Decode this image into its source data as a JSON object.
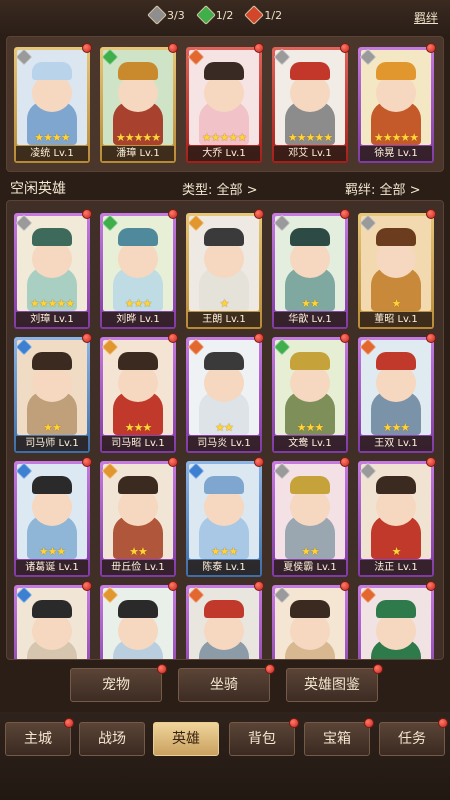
{
  "resources": [
    {
      "icon": "gray-gem-icon",
      "value": "3/3",
      "color": "#8e8e8e"
    },
    {
      "icon": "green-gem-icon",
      "value": "1/2",
      "color": "#3fae4b"
    },
    {
      "icon": "red-gem-icon",
      "value": "1/2",
      "color": "#d2472c"
    }
  ],
  "bond_link": "羁绊",
  "team": [
    {
      "name": "凌统 Lv.1",
      "frame": "gold",
      "elem": "#9a9a9a",
      "stars": "★★★★",
      "bg": "#dbe6f0",
      "clothes": "#7ea6cf",
      "hat": "#b9d3ea"
    },
    {
      "name": "潘璋 Lv.1",
      "frame": "gold",
      "elem": "#3fae4b",
      "stars": "★★★★★",
      "bg": "#cfe3c6",
      "clothes": "#a8422f",
      "hat": "#c98a2e"
    },
    {
      "name": "大乔 Lv.1",
      "frame": "red",
      "elem": "#e2682f",
      "stars": "★★★★★",
      "bg": "#f6e4e4",
      "clothes": "#f1c2c8",
      "hat": "#3a2a24"
    },
    {
      "name": "邓艾 Lv.1",
      "frame": "red",
      "elem": "#9a9a9a",
      "stars": "★★★★★",
      "bg": "#f1ece6",
      "clothes": "#8c8c8c",
      "hat": "#c2372a"
    },
    {
      "name": "徐晃 Lv.1",
      "frame": "purple",
      "elem": "#9a9a9a",
      "stars": "★★★★★",
      "bg": "#f4e7c4",
      "clothes": "#c45a2a",
      "hat": "#e2962e"
    }
  ],
  "idle_section": {
    "title": "空闲英雄",
    "type_filter": "类型: 全部 >",
    "bond_filter": "羁绊: 全部 >"
  },
  "idle_heroes": [
    {
      "name": "刘璋 Lv.1",
      "frame": "purple",
      "elem": "#9a9a9a",
      "stars": "★★★★★",
      "bg": "#f2ead8",
      "clothes": "#a9cfc2",
      "hat": "#3d6a5a"
    },
    {
      "name": "刘晔 Lv.1",
      "frame": "purple",
      "elem": "#3fae4b",
      "stars": "★★★",
      "bg": "#e8efd7",
      "clothes": "#bfdce4",
      "hat": "#4f8a9c"
    },
    {
      "name": "王朗 Lv.1",
      "frame": "gold",
      "elem": "#e2962e",
      "stars": "★",
      "bg": "#eeeae3",
      "clothes": "#e5e2d9",
      "hat": "#3a3a3a"
    },
    {
      "name": "华歆 Lv.1",
      "frame": "purple",
      "elem": "#9a9a9a",
      "stars": "★★",
      "bg": "#e3eedf",
      "clothes": "#7fa8a0",
      "hat": "#2d4a44"
    },
    {
      "name": "董昭 Lv.1",
      "frame": "gold",
      "elem": "#9a9a9a",
      "stars": "★",
      "bg": "#f2d9b0",
      "clothes": "#c88a3a",
      "hat": "#6b3d1e"
    },
    {
      "name": "司马师 Lv.1",
      "frame": "blue",
      "elem": "#3d7fd1",
      "stars": "★★",
      "bg": "#f0dcc4",
      "clothes": "#bfa07a",
      "hat": "#3a2a20"
    },
    {
      "name": "司马昭 Lv.1",
      "frame": "purple",
      "elem": "#e2962e",
      "stars": "★★★",
      "bg": "#f4e4d4",
      "clothes": "#c0392b",
      "hat": "#3a2a20"
    },
    {
      "name": "司马炎 Lv.1",
      "frame": "purple",
      "elem": "#e2682f",
      "stars": "★★",
      "bg": "#eef2f4",
      "clothes": "#dde3e6",
      "hat": "#3a3a3a"
    },
    {
      "name": "文鸯 Lv.1",
      "frame": "purple",
      "elem": "#3fae4b",
      "stars": "★★★",
      "bg": "#e6efd3",
      "clothes": "#7f8f5a",
      "hat": "#c6a23a"
    },
    {
      "name": "王双 Lv.1",
      "frame": "purple",
      "elem": "#e2682f",
      "stars": "★★★",
      "bg": "#e0eaf1",
      "clothes": "#7b93a8",
      "hat": "#c0392b"
    },
    {
      "name": "诸葛诞 Lv.1",
      "frame": "purple",
      "elem": "#3d7fd1",
      "stars": "★★★",
      "bg": "#dce9f2",
      "clothes": "#8fb6d6",
      "hat": "#2a2a2a"
    },
    {
      "name": "毌丘俭 Lv.1",
      "frame": "purple",
      "elem": "#e2962e",
      "stars": "★★",
      "bg": "#f1e6d6",
      "clothes": "#b0563a",
      "hat": "#3a2a20"
    },
    {
      "name": "陈泰 Lv.1",
      "frame": "blue",
      "elem": "#3d7fd1",
      "stars": "★★★",
      "bg": "#dbe8f2",
      "clothes": "#a9c8e6",
      "hat": "#7ea6cf"
    },
    {
      "name": "夏侯霸 Lv.1",
      "frame": "purple",
      "elem": "#9a9a9a",
      "stars": "★★",
      "bg": "#f4e1e6",
      "clothes": "#9aa6b0",
      "hat": "#c6a23a"
    },
    {
      "name": "法正 Lv.1",
      "frame": "purple",
      "elem": "#9a9a9a",
      "stars": "★",
      "bg": "#f1e3d2",
      "clothes": "#c0392b",
      "hat": "#3a2a20"
    },
    {
      "name": "",
      "frame": "purple",
      "elem": "#3d7fd1",
      "stars": "",
      "bg": "#f1e6d6",
      "clothes": "#d6c6b0",
      "hat": "#2a2a2a"
    },
    {
      "name": "",
      "frame": "purple",
      "elem": "#e2962e",
      "stars": "",
      "bg": "#e9efe9",
      "clothes": "#b9cfe0",
      "hat": "#2a2a2a"
    },
    {
      "name": "",
      "frame": "purple",
      "elem": "#e2682f",
      "stars": "",
      "bg": "#e9e6e0",
      "clothes": "#8c9ba8",
      "hat": "#c0392b"
    },
    {
      "name": "",
      "frame": "purple",
      "elem": "#9a9a9a",
      "stars": "",
      "bg": "#f4e6d2",
      "clothes": "#d8b890",
      "hat": "#3a2a20"
    },
    {
      "name": "",
      "frame": "purple",
      "elem": "#e2682f",
      "stars": "",
      "bg": "#f1e3e3",
      "clothes": "#2f7a4a",
      "hat": "#2f7a4a"
    }
  ],
  "sub_buttons": [
    "宠物",
    "坐骑",
    "英雄图鉴"
  ],
  "nav": [
    "主城",
    "战场",
    "英雄",
    "背包",
    "宝箱",
    "任务"
  ],
  "nav_active": "英雄",
  "badge_color": "#d0342a"
}
